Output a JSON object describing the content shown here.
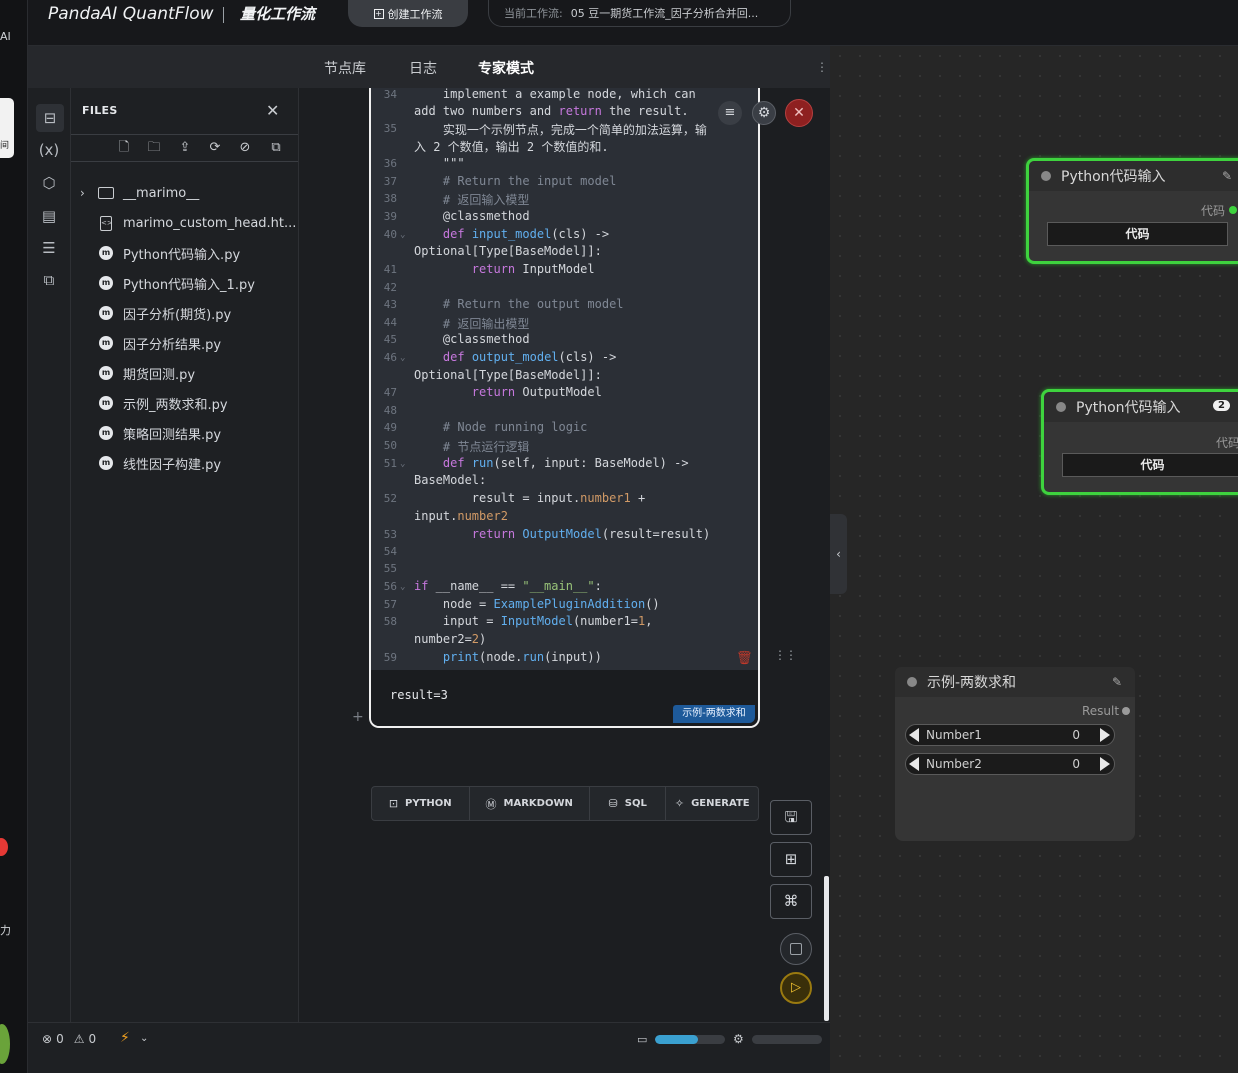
{
  "app": {
    "logo": "PandaAI QuantFlow",
    "subtitle": "量化工作流",
    "create_button": "创建工作流",
    "workflow_label": "当前工作流:",
    "workflow_name": "05 豆一期货工作流_因子分析合并回..."
  },
  "far_left": {
    "top_text": "AI",
    "card_text": "间",
    "bottom_text": "力"
  },
  "panel_tabs": [
    "节点库",
    "日志",
    "专家模式"
  ],
  "active_tab": "专家模式",
  "rail_icons": [
    "file-tree-icon",
    "variables-icon",
    "package-icon",
    "snippets-icon",
    "outline-icon",
    "dependency-graph-icon"
  ],
  "files": {
    "title": "FILES",
    "toolbar": [
      "new-file-icon",
      "new-folder-icon",
      "upload-icon",
      "refresh-icon",
      "hide-icon",
      "copy-icon"
    ],
    "items": [
      {
        "name": "__marimo__",
        "type": "folder"
      },
      {
        "name": "marimo_custom_head.ht...",
        "type": "html"
      },
      {
        "name": "Python代码输入.py",
        "type": "marimo"
      },
      {
        "name": "Python代码输入_1.py",
        "type": "marimo"
      },
      {
        "name": "因子分析(期货).py",
        "type": "marimo"
      },
      {
        "name": "因子分析结果.py",
        "type": "marimo"
      },
      {
        "name": "期货回测.py",
        "type": "marimo"
      },
      {
        "name": "示例_两数求和.py",
        "type": "marimo"
      },
      {
        "name": "策略回测结果.py",
        "type": "marimo"
      },
      {
        "name": "线性因子构建.py",
        "type": "marimo"
      }
    ]
  },
  "code": {
    "lines": [
      {
        "n": "34",
        "t": "    implement a example node, which can"
      },
      {
        "n": "",
        "t": "add two numbers and return the result."
      },
      {
        "n": "35",
        "t": "    实现一个示例节点，完成一个简单的加法运算，输"
      },
      {
        "n": "",
        "t": "入 2 个数值，输出 2 个数值的和."
      },
      {
        "n": "36",
        "t": "    \"\"\""
      },
      {
        "n": "37",
        "t": "    # Return the input model"
      },
      {
        "n": "38",
        "t": "    # 返回输入模型"
      },
      {
        "n": "39",
        "t": "    @classmethod"
      },
      {
        "n": "40",
        "t": "    def input_model(cls) ->"
      },
      {
        "n": "",
        "t": "Optional[Type[BaseModel]]:"
      },
      {
        "n": "41",
        "t": "        return InputModel"
      },
      {
        "n": "42",
        "t": ""
      },
      {
        "n": "43",
        "t": "    # Return the output model"
      },
      {
        "n": "44",
        "t": "    # 返回输出模型"
      },
      {
        "n": "45",
        "t": "    @classmethod"
      },
      {
        "n": "46",
        "t": "    def output_model(cls) ->"
      },
      {
        "n": "",
        "t": "Optional[Type[BaseModel]]:"
      },
      {
        "n": "47",
        "t": "        return OutputModel"
      },
      {
        "n": "48",
        "t": ""
      },
      {
        "n": "49",
        "t": "    # Node running logic"
      },
      {
        "n": "50",
        "t": "    # 节点运行逻辑"
      },
      {
        "n": "51",
        "t": "    def run(self, input: BaseModel) ->"
      },
      {
        "n": "",
        "t": "BaseModel:"
      },
      {
        "n": "52",
        "t": "        result = input.number1 +"
      },
      {
        "n": "",
        "t": "input.number2"
      },
      {
        "n": "53",
        "t": "        return OutputModel(result=result)"
      },
      {
        "n": "54",
        "t": ""
      },
      {
        "n": "55",
        "t": ""
      },
      {
        "n": "56",
        "t": "if __name__ == \"__main__\":"
      },
      {
        "n": "57",
        "t": "    node = ExamplePluginAddition()"
      },
      {
        "n": "58",
        "t": "    input = InputModel(number1=1,"
      },
      {
        "n": "",
        "t": "number2=2)"
      },
      {
        "n": "59",
        "t": "    print(node.run(input))"
      }
    ],
    "fold_lines": [
      "40",
      "46",
      "51",
      "56"
    ]
  },
  "output": {
    "text": "result=3",
    "badge": "示例-两数求和"
  },
  "add_cell_bar": {
    "python": "PYTHON",
    "markdown": "MARKDOWN",
    "sql": "SQL",
    "generate": "GENERATE"
  },
  "status": {
    "errors": "0",
    "warnings": "0",
    "memory_fraction": 0.62,
    "cpu_fraction": 0.0
  },
  "canvas": {
    "node1": {
      "title": "Python代码输入",
      "output_label": "代码",
      "button": "代码"
    },
    "node2": {
      "title": "Python代码输入",
      "badge": "2",
      "output_label": "代码",
      "button": "代码"
    },
    "node3": {
      "title": "示例-两数求和",
      "output_label": "Result",
      "widgets": [
        {
          "name": "Number1",
          "value": "0"
        },
        {
          "name": "Number2",
          "value": "0"
        }
      ]
    }
  }
}
